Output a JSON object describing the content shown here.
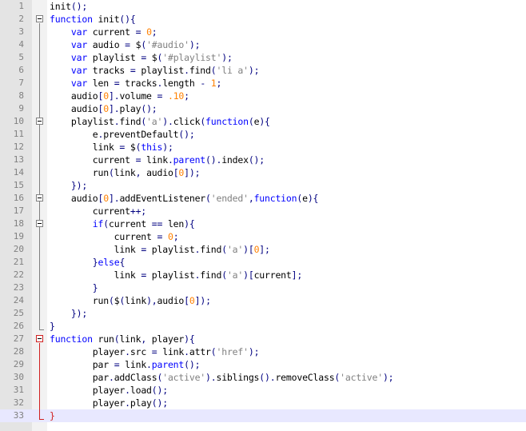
{
  "editor": {
    "current_line": 33,
    "lines": [
      [
        {
          "t": "init",
          "c": "p"
        },
        {
          "t": "();",
          "c": "n"
        }
      ],
      [
        {
          "t": "function",
          "c": "k"
        },
        {
          "t": " init",
          "c": "p"
        },
        {
          "t": "(){",
          "c": "n"
        }
      ],
      [
        {
          "t": "    ",
          "c": "p"
        },
        {
          "t": "var",
          "c": "k"
        },
        {
          "t": " current ",
          "c": "p"
        },
        {
          "t": "=",
          "c": "n"
        },
        {
          "t": " ",
          "c": "p"
        },
        {
          "t": "0",
          "c": "d"
        },
        {
          "t": ";",
          "c": "n"
        }
      ],
      [
        {
          "t": "    ",
          "c": "p"
        },
        {
          "t": "var",
          "c": "k"
        },
        {
          "t": " audio ",
          "c": "p"
        },
        {
          "t": "=",
          "c": "n"
        },
        {
          "t": " $",
          "c": "p"
        },
        {
          "t": "(",
          "c": "n"
        },
        {
          "t": "'#audio'",
          "c": "s"
        },
        {
          "t": ");",
          "c": "n"
        }
      ],
      [
        {
          "t": "    ",
          "c": "p"
        },
        {
          "t": "var",
          "c": "k"
        },
        {
          "t": " playlist ",
          "c": "p"
        },
        {
          "t": "=",
          "c": "n"
        },
        {
          "t": " $",
          "c": "p"
        },
        {
          "t": "(",
          "c": "n"
        },
        {
          "t": "'#playlist'",
          "c": "s"
        },
        {
          "t": ");",
          "c": "n"
        }
      ],
      [
        {
          "t": "    ",
          "c": "p"
        },
        {
          "t": "var",
          "c": "k"
        },
        {
          "t": " tracks ",
          "c": "p"
        },
        {
          "t": "=",
          "c": "n"
        },
        {
          "t": " playlist",
          "c": "p"
        },
        {
          "t": ".",
          "c": "n"
        },
        {
          "t": "find",
          "c": "p"
        },
        {
          "t": "(",
          "c": "n"
        },
        {
          "t": "'li a'",
          "c": "s"
        },
        {
          "t": ");",
          "c": "n"
        }
      ],
      [
        {
          "t": "    ",
          "c": "p"
        },
        {
          "t": "var",
          "c": "k"
        },
        {
          "t": " len ",
          "c": "p"
        },
        {
          "t": "=",
          "c": "n"
        },
        {
          "t": " tracks",
          "c": "p"
        },
        {
          "t": ".",
          "c": "n"
        },
        {
          "t": "length ",
          "c": "p"
        },
        {
          "t": "-",
          "c": "n"
        },
        {
          "t": " ",
          "c": "p"
        },
        {
          "t": "1",
          "c": "d"
        },
        {
          "t": ";",
          "c": "n"
        }
      ],
      [
        {
          "t": "    audio",
          "c": "p"
        },
        {
          "t": "[",
          "c": "n"
        },
        {
          "t": "0",
          "c": "d"
        },
        {
          "t": "].",
          "c": "n"
        },
        {
          "t": "volume ",
          "c": "p"
        },
        {
          "t": "=",
          "c": "n"
        },
        {
          "t": " ",
          "c": "p"
        },
        {
          "t": ".10",
          "c": "d"
        },
        {
          "t": ";",
          "c": "n"
        }
      ],
      [
        {
          "t": "    audio",
          "c": "p"
        },
        {
          "t": "[",
          "c": "n"
        },
        {
          "t": "0",
          "c": "d"
        },
        {
          "t": "].",
          "c": "n"
        },
        {
          "t": "play",
          "c": "p"
        },
        {
          "t": "();",
          "c": "n"
        }
      ],
      [
        {
          "t": "    playlist",
          "c": "p"
        },
        {
          "t": ".",
          "c": "n"
        },
        {
          "t": "find",
          "c": "p"
        },
        {
          "t": "(",
          "c": "n"
        },
        {
          "t": "'a'",
          "c": "s"
        },
        {
          "t": ").",
          "c": "n"
        },
        {
          "t": "click",
          "c": "p"
        },
        {
          "t": "(",
          "c": "n"
        },
        {
          "t": "function",
          "c": "k"
        },
        {
          "t": "(",
          "c": "n"
        },
        {
          "t": "e",
          "c": "p"
        },
        {
          "t": "){",
          "c": "n"
        }
      ],
      [
        {
          "t": "        e",
          "c": "p"
        },
        {
          "t": ".",
          "c": "n"
        },
        {
          "t": "preventDefault",
          "c": "p"
        },
        {
          "t": "();",
          "c": "n"
        }
      ],
      [
        {
          "t": "        link ",
          "c": "p"
        },
        {
          "t": "=",
          "c": "n"
        },
        {
          "t": " $",
          "c": "p"
        },
        {
          "t": "(",
          "c": "n"
        },
        {
          "t": "this",
          "c": "k"
        },
        {
          "t": ");",
          "c": "n"
        }
      ],
      [
        {
          "t": "        current ",
          "c": "p"
        },
        {
          "t": "=",
          "c": "n"
        },
        {
          "t": " link",
          "c": "p"
        },
        {
          "t": ".",
          "c": "n"
        },
        {
          "t": "parent",
          "c": "k"
        },
        {
          "t": "().",
          "c": "n"
        },
        {
          "t": "index",
          "c": "p"
        },
        {
          "t": "();",
          "c": "n"
        }
      ],
      [
        {
          "t": "        run",
          "c": "p"
        },
        {
          "t": "(",
          "c": "n"
        },
        {
          "t": "link",
          "c": "p"
        },
        {
          "t": ",",
          "c": "n"
        },
        {
          "t": " audio",
          "c": "p"
        },
        {
          "t": "[",
          "c": "n"
        },
        {
          "t": "0",
          "c": "d"
        },
        {
          "t": "]);",
          "c": "n"
        }
      ],
      [
        {
          "t": "    ",
          "c": "p"
        },
        {
          "t": "});",
          "c": "n"
        }
      ],
      [
        {
          "t": "    audio",
          "c": "p"
        },
        {
          "t": "[",
          "c": "n"
        },
        {
          "t": "0",
          "c": "d"
        },
        {
          "t": "].",
          "c": "n"
        },
        {
          "t": "addEventListener",
          "c": "p"
        },
        {
          "t": "(",
          "c": "n"
        },
        {
          "t": "'ended'",
          "c": "s"
        },
        {
          "t": ",",
          "c": "n"
        },
        {
          "t": "function",
          "c": "k"
        },
        {
          "t": "(",
          "c": "n"
        },
        {
          "t": "e",
          "c": "p"
        },
        {
          "t": "){",
          "c": "n"
        }
      ],
      [
        {
          "t": "        current",
          "c": "p"
        },
        {
          "t": "++;",
          "c": "n"
        }
      ],
      [
        {
          "t": "        ",
          "c": "p"
        },
        {
          "t": "if",
          "c": "k"
        },
        {
          "t": "(",
          "c": "n"
        },
        {
          "t": "current ",
          "c": "p"
        },
        {
          "t": "==",
          "c": "n"
        },
        {
          "t": " len",
          "c": "p"
        },
        {
          "t": "){",
          "c": "n"
        }
      ],
      [
        {
          "t": "            current ",
          "c": "p"
        },
        {
          "t": "=",
          "c": "n"
        },
        {
          "t": " ",
          "c": "p"
        },
        {
          "t": "0",
          "c": "d"
        },
        {
          "t": ";",
          "c": "n"
        }
      ],
      [
        {
          "t": "            link ",
          "c": "p"
        },
        {
          "t": "=",
          "c": "n"
        },
        {
          "t": " playlist",
          "c": "p"
        },
        {
          "t": ".",
          "c": "n"
        },
        {
          "t": "find",
          "c": "p"
        },
        {
          "t": "(",
          "c": "n"
        },
        {
          "t": "'a'",
          "c": "s"
        },
        {
          "t": ")[",
          "c": "n"
        },
        {
          "t": "0",
          "c": "d"
        },
        {
          "t": "];",
          "c": "n"
        }
      ],
      [
        {
          "t": "        ",
          "c": "p"
        },
        {
          "t": "}",
          "c": "n"
        },
        {
          "t": "else",
          "c": "k"
        },
        {
          "t": "{",
          "c": "n"
        }
      ],
      [
        {
          "t": "            link ",
          "c": "p"
        },
        {
          "t": "=",
          "c": "n"
        },
        {
          "t": " playlist",
          "c": "p"
        },
        {
          "t": ".",
          "c": "n"
        },
        {
          "t": "find",
          "c": "p"
        },
        {
          "t": "(",
          "c": "n"
        },
        {
          "t": "'a'",
          "c": "s"
        },
        {
          "t": ")[",
          "c": "n"
        },
        {
          "t": "current",
          "c": "p"
        },
        {
          "t": "];",
          "c": "n"
        }
      ],
      [
        {
          "t": "        ",
          "c": "p"
        },
        {
          "t": "}",
          "c": "n"
        }
      ],
      [
        {
          "t": "        run",
          "c": "p"
        },
        {
          "t": "(",
          "c": "n"
        },
        {
          "t": "$",
          "c": "p"
        },
        {
          "t": "(",
          "c": "n"
        },
        {
          "t": "link",
          "c": "p"
        },
        {
          "t": "),",
          "c": "n"
        },
        {
          "t": "audio",
          "c": "p"
        },
        {
          "t": "[",
          "c": "n"
        },
        {
          "t": "0",
          "c": "d"
        },
        {
          "t": "]);",
          "c": "n"
        }
      ],
      [
        {
          "t": "    ",
          "c": "p"
        },
        {
          "t": "});",
          "c": "n"
        }
      ],
      [
        {
          "t": "}",
          "c": "n"
        }
      ],
      [
        {
          "t": "function",
          "c": "k"
        },
        {
          "t": " run",
          "c": "p"
        },
        {
          "t": "(",
          "c": "n"
        },
        {
          "t": "link",
          "c": "p"
        },
        {
          "t": ",",
          "c": "n"
        },
        {
          "t": " player",
          "c": "p"
        },
        {
          "t": "){",
          "c": "n"
        }
      ],
      [
        {
          "t": "        player",
          "c": "p"
        },
        {
          "t": ".",
          "c": "n"
        },
        {
          "t": "src ",
          "c": "p"
        },
        {
          "t": "=",
          "c": "n"
        },
        {
          "t": " link",
          "c": "p"
        },
        {
          "t": ".",
          "c": "n"
        },
        {
          "t": "attr",
          "c": "p"
        },
        {
          "t": "(",
          "c": "n"
        },
        {
          "t": "'href'",
          "c": "s"
        },
        {
          "t": ");",
          "c": "n"
        }
      ],
      [
        {
          "t": "        par ",
          "c": "p"
        },
        {
          "t": "=",
          "c": "n"
        },
        {
          "t": " link",
          "c": "p"
        },
        {
          "t": ".",
          "c": "n"
        },
        {
          "t": "parent",
          "c": "k"
        },
        {
          "t": "();",
          "c": "n"
        }
      ],
      [
        {
          "t": "        par",
          "c": "p"
        },
        {
          "t": ".",
          "c": "n"
        },
        {
          "t": "addClass",
          "c": "p"
        },
        {
          "t": "(",
          "c": "n"
        },
        {
          "t": "'active'",
          "c": "s"
        },
        {
          "t": ").",
          "c": "n"
        },
        {
          "t": "siblings",
          "c": "p"
        },
        {
          "t": "().",
          "c": "n"
        },
        {
          "t": "removeClass",
          "c": "p"
        },
        {
          "t": "(",
          "c": "n"
        },
        {
          "t": "'active'",
          "c": "s"
        },
        {
          "t": ");",
          "c": "n"
        }
      ],
      [
        {
          "t": "        player",
          "c": "p"
        },
        {
          "t": ".",
          "c": "n"
        },
        {
          "t": "load",
          "c": "p"
        },
        {
          "t": "();",
          "c": "n"
        }
      ],
      [
        {
          "t": "        player",
          "c": "p"
        },
        {
          "t": ".",
          "c": "n"
        },
        {
          "t": "play",
          "c": "p"
        },
        {
          "t": "();",
          "c": "n"
        }
      ],
      [
        {
          "t": "}",
          "c": "r"
        }
      ]
    ]
  }
}
